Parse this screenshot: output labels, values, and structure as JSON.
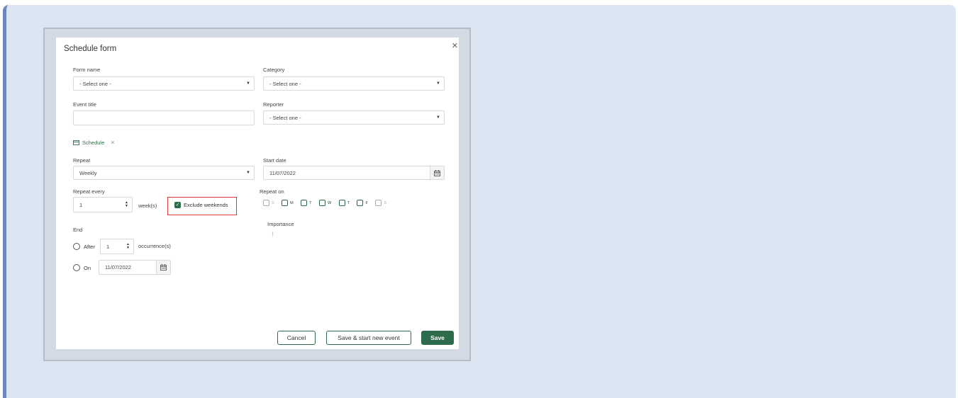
{
  "dialog": {
    "title": "Schedule form",
    "close_glyph": "×"
  },
  "form": {
    "form_name": {
      "label": "Form name",
      "value": "- Select one -"
    },
    "category": {
      "label": "Category",
      "value": "- Select one -"
    },
    "event_title": {
      "label": "Event title",
      "value": ""
    },
    "reporter": {
      "label": "Reporter",
      "value": "- Select one -"
    }
  },
  "schedule": {
    "tag_label": "Schedule",
    "tag_icon": "calendar-icon",
    "repeat": {
      "label": "Repeat",
      "value": "Weekly"
    },
    "start_date": {
      "label": "Start date",
      "value": "11/07/2022"
    },
    "repeat_every": {
      "label": "Repeat every",
      "value": "1",
      "unit": "week(s)"
    },
    "exclude_weekends": {
      "label": "Exclude weekends",
      "checked": true
    },
    "repeat_on": {
      "label": "Repeat on",
      "days": [
        {
          "letter": "S",
          "enabled": false,
          "checked": false
        },
        {
          "letter": "M",
          "enabled": true,
          "checked": false
        },
        {
          "letter": "T",
          "enabled": true,
          "checked": false
        },
        {
          "letter": "W",
          "enabled": true,
          "checked": false
        },
        {
          "letter": "T",
          "enabled": true,
          "checked": false
        },
        {
          "letter": "F",
          "enabled": true,
          "checked": false
        },
        {
          "letter": "S",
          "enabled": false,
          "checked": false
        }
      ]
    },
    "importance": {
      "label": "Importance",
      "icon": "exclamation-icon"
    },
    "end": {
      "label": "End",
      "after_label": "After",
      "after_value": "1",
      "after_unit": "occurrence(s)",
      "on_label": "On",
      "on_value": "11/07/2022"
    }
  },
  "buttons": {
    "cancel": "Cancel",
    "save_new": "Save & start new event",
    "save": "Save"
  },
  "colors": {
    "accent": "#2e6b4a",
    "highlight": "#e03a3a",
    "stage_bg": "#dce5f2"
  }
}
